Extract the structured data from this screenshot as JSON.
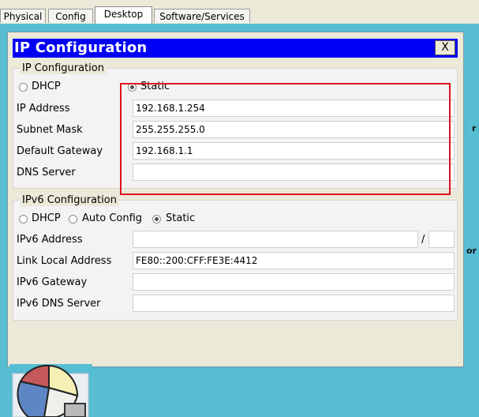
{
  "tabs": [
    {
      "label": "Physical"
    },
    {
      "label": "Config"
    },
    {
      "label": "Desktop"
    },
    {
      "label": "Software/Services"
    }
  ],
  "dialog": {
    "title": "IP Configuration",
    "close_label": "X"
  },
  "ipv4": {
    "group_title": "IP Configuration",
    "dhcp_label": "DHCP",
    "static_label": "Static",
    "mode": "Static",
    "fields": [
      {
        "label": "IP Address",
        "value": "192.168.1.254"
      },
      {
        "label": "Subnet Mask",
        "value": "255.255.255.0"
      },
      {
        "label": "Default Gateway",
        "value": "192.168.1.1"
      },
      {
        "label": "DNS Server",
        "value": ""
      }
    ]
  },
  "ipv6": {
    "group_title": "IPv6 Configuration",
    "dhcp_label": "DHCP",
    "auto_label": "Auto Config",
    "static_label": "Static",
    "mode": "Static",
    "address_label": "IPv6 Address",
    "address_value": "",
    "prefix_separator": "/",
    "prefix_value": "",
    "link_local_label": "Link Local Address",
    "link_local_value": "FE80::200:CFF:FE3E:4412",
    "gateway_label": "IPv6 Gateway",
    "gateway_value": "",
    "dns_label": "IPv6 DNS Server",
    "dns_value": ""
  },
  "edge_letters": [
    "r",
    "or"
  ],
  "colors": {
    "titlebar": "#0000f5",
    "highlight": "#e0101c",
    "background": "#56bdd3"
  }
}
